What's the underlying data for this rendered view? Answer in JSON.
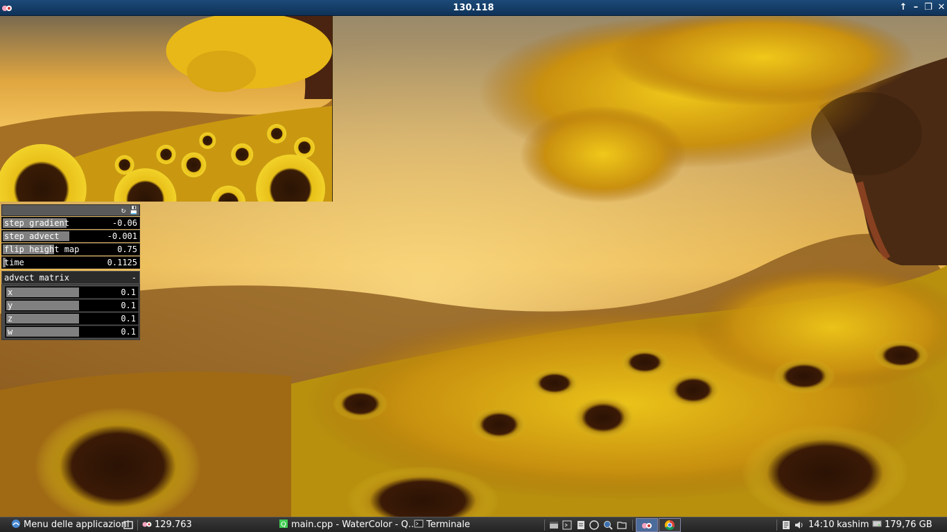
{
  "window": {
    "title": "130.118",
    "controls": {
      "up_icon": "arrow-up-icon",
      "minimize_icon": "minimize-icon",
      "restore_icon": "restore-icon",
      "close_icon": "close-icon"
    }
  },
  "gui": {
    "header_icons": [
      "refresh-icon",
      "save-icon"
    ],
    "params": [
      {
        "label": "step gradient",
        "value": "-0.06",
        "level": 0.47
      },
      {
        "label": "step advect",
        "value": "-0.001",
        "level": 0.49
      },
      {
        "label": "flip height map",
        "value": "0.75",
        "level": 0.38
      },
      {
        "label": "time",
        "value": "0.1125",
        "level": 0.02
      }
    ],
    "group": {
      "label": "advect matrix",
      "collapse": "-",
      "params": [
        {
          "label": "x",
          "value": "0.1",
          "level": 0.55
        },
        {
          "label": "y",
          "value": "0.1",
          "level": 0.55
        },
        {
          "label": "z",
          "value": "0.1",
          "level": 0.55
        },
        {
          "label": "w",
          "value": "0.1",
          "level": 0.55
        }
      ]
    }
  },
  "taskbar": {
    "menu_label": "Menu delle applicazioni",
    "task_app": "129.763",
    "task_editor": "main.cpp - WaterColor - Q...",
    "task_terminal": "Terminale",
    "launchers": [
      "window-icon",
      "terminal-icon",
      "files-icon",
      "editor-icon",
      "search-icon",
      "folder-icon"
    ],
    "clock": "14:10",
    "user": "kashim",
    "disk": "179,76 GB"
  },
  "colors": {
    "titlebar": "#0f3258",
    "gui_fill": "#808080",
    "taskbar": "#2b2b2b"
  }
}
